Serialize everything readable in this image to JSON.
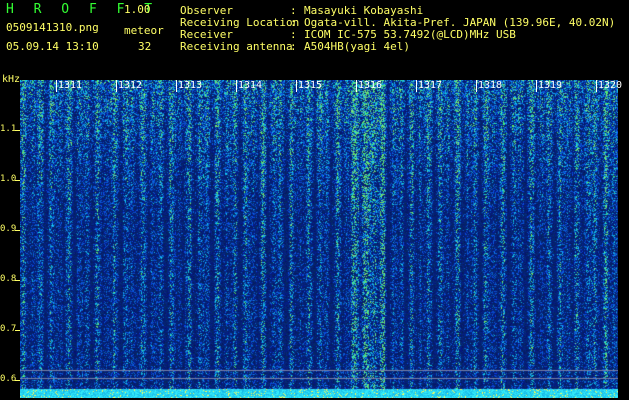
{
  "header": {
    "app_title": "H R O F F T",
    "app_version": "1.00",
    "file_name": "0509141310.png",
    "meteor_label": "meteor",
    "timestamp": "05.09.14 13:10",
    "meteor_count": "32"
  },
  "info": [
    {
      "key": "Observer",
      "value": "Masayuki Kobayashi"
    },
    {
      "key": "Receiving Location",
      "value": "Ogata-vill. Akita-Pref. JAPAN (139.96E, 40.02N)"
    },
    {
      "key": "Receiver",
      "value": "ICOM IC-575 53.7492(@LCD)MHz USB"
    },
    {
      "key": "Receiving antenna",
      "value": "A504HB(yagi 4el)"
    }
  ],
  "axis": {
    "unit": "kHz",
    "y_ticks": [
      "1.1",
      "1.0",
      "0.9",
      "0.8",
      "0.7",
      "0.6"
    ],
    "x_ticks": [
      "1311",
      "1312",
      "1313",
      "1314",
      "1315",
      "1316",
      "1317",
      "1318",
      "1319",
      "1320"
    ]
  },
  "colors": {
    "label_yellow": "#ffff66",
    "title_green": "#33ff33",
    "spectrum_base": "#0a1f78",
    "baseline_cyan": "#33ddff"
  }
}
